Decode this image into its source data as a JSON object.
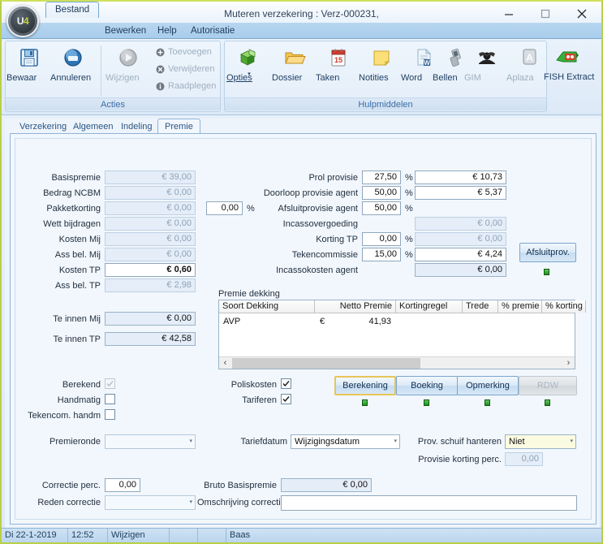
{
  "window": {
    "title": "Muteren verzekering : Verz-000231,",
    "minimize": "minimize-icon",
    "maximize": "maximize-icon",
    "close": "close-icon",
    "orb_u": "U",
    "orb_4": "4"
  },
  "menu": {
    "tabs": [
      {
        "label": "Bestand",
        "active": true
      },
      {
        "label": "Bewerken",
        "active": false
      },
      {
        "label": "Help",
        "active": false
      },
      {
        "label": "Autorisatie",
        "active": false
      }
    ]
  },
  "ribbon": {
    "groups": [
      {
        "name": "Acties"
      },
      {
        "name": "Hulpmiddelen"
      }
    ],
    "acties": {
      "buttons": [
        {
          "label": "Bewaar",
          "icon": "save-icon",
          "disabled": false
        },
        {
          "label": "Annuleren",
          "icon": "cancel-icon",
          "disabled": false
        },
        {
          "label": "Wijzigen",
          "icon": "edit-icon",
          "disabled": true
        }
      ],
      "small_items": [
        {
          "label": "Toevoegen",
          "icon": "add-icon"
        },
        {
          "label": "Verwijderen",
          "icon": "delete-icon"
        },
        {
          "label": "Raadplegen",
          "icon": "info-icon"
        }
      ]
    },
    "hulpmiddelen": {
      "buttons": [
        {
          "label": "Opties",
          "icon": "options-cube-icon",
          "disabled": false,
          "has_dropdown": true
        },
        {
          "label": "Dossier",
          "icon": "folder-icon",
          "disabled": false
        },
        {
          "label": "Taken",
          "icon": "calendar-icon",
          "disabled": false
        },
        {
          "label": "Notities",
          "icon": "note-icon",
          "disabled": false
        },
        {
          "label": "Word",
          "icon": "word-doc-icon",
          "disabled": false
        },
        {
          "label": "Bellen",
          "icon": "phone-icon",
          "disabled": false
        },
        {
          "label": "GIM",
          "icon": "gim-icon",
          "disabled": true
        },
        {
          "label": "Aplaza",
          "icon": "aplaza-icon",
          "disabled": true
        },
        {
          "label": "FISH Extract",
          "icon": "fish-extract-icon",
          "disabled": false
        }
      ]
    }
  },
  "form_tabs": [
    {
      "label": "Verzekering",
      "active": false
    },
    {
      "label": "Algemeen",
      "active": false
    },
    {
      "label": "Indeling",
      "active": false
    },
    {
      "label": "Premie",
      "active": true
    }
  ],
  "left_fields": [
    {
      "label": "Basispremie",
      "value": "€ 39,00",
      "readonly": true
    },
    {
      "label": "Bedrag NCBM",
      "value": "€ 0,00",
      "readonly": true
    },
    {
      "label": "Pakketkorting",
      "value": "€ 0,00",
      "readonly": true
    },
    {
      "label": "Wett bijdragen",
      "value": "€ 0,00",
      "readonly": true
    },
    {
      "label": "Kosten Mij",
      "value": "€ 0,00",
      "readonly": true
    },
    {
      "label": "Ass bel. Mij",
      "value": "€ 0,00",
      "readonly": true
    },
    {
      "label": "Kosten TP",
      "value": "€ 0,60",
      "readonly": false
    },
    {
      "label": "Ass bel. TP",
      "value": "€ 2,98",
      "readonly": true
    }
  ],
  "totals": [
    {
      "label": "Te innen Mij",
      "value": "€ 0,00"
    },
    {
      "label": "Te innen TP",
      "value": "€ 42,58"
    }
  ],
  "provision": {
    "rows": [
      {
        "label": "Prol provisie",
        "pct": "27,50",
        "pct_sign": "%",
        "amount": "€ 10,73",
        "amount_readonly": false,
        "has_pct": true,
        "has_amount": true
      },
      {
        "label": "Doorloop provisie agent",
        "pct": "50,00",
        "pct_sign": "%",
        "amount": "€ 5,37",
        "amount_readonly": false,
        "has_pct": true,
        "has_amount": true
      },
      {
        "label": "Afsluitprovisie agent",
        "pct": "50,00",
        "pct_sign": "%",
        "amount": "",
        "amount_readonly": false,
        "has_pct": true,
        "has_amount": false
      },
      {
        "label": "Incassovergoeding",
        "pct": "",
        "pct_sign": "",
        "amount": "€ 0,00",
        "amount_readonly": true,
        "has_pct": false,
        "has_amount": true
      },
      {
        "label": "Korting TP",
        "pct": "0,00",
        "pct_sign": "%",
        "amount": "€ 0,00",
        "amount_readonly": true,
        "has_pct": true,
        "has_amount": true
      },
      {
        "label": "Tekencommissie",
        "pct": "15,00",
        "pct_sign": "%",
        "amount": "€ 4,24",
        "amount_readonly": false,
        "has_pct": true,
        "has_amount": true
      },
      {
        "label": "Incassokosten agent",
        "pct": "",
        "pct_sign": "",
        "amount": "€ 0,00",
        "amount_readonly": true,
        "has_pct": false,
        "has_amount": true
      }
    ],
    "extra_pct_value": "0,00",
    "extra_pct_sign": "%",
    "afsluitprov_button": "Afsluitprov."
  },
  "grid": {
    "caption": "Premie dekking",
    "columns": [
      "Soort Dekking",
      "",
      "Netto Premie",
      "Kortingregel",
      "Trede",
      "% premie",
      "% korting"
    ],
    "rows": [
      {
        "soort_dekking": "AVP",
        "currency": "€",
        "netto_premie": "41,93",
        "kortingregel": "",
        "trede": "",
        "pct_premie": "",
        "pct_korting": ""
      }
    ],
    "scroll_left_arrow": "‹",
    "scroll_right_arrow": "›"
  },
  "checkboxes_left": [
    {
      "label": "Berekend",
      "checked": true,
      "disabled": true
    },
    {
      "label": "Handmatig",
      "checked": false,
      "disabled": false
    },
    {
      "label": "Tekencom. handm",
      "checked": false,
      "disabled": false
    }
  ],
  "checkboxes_mid": [
    {
      "label": "Poliskosten",
      "checked": true,
      "disabled": false
    },
    {
      "label": "Tariferen",
      "checked": true,
      "disabled": false
    }
  ],
  "action_buttons": [
    {
      "label": "Berekening",
      "disabled": false,
      "focused": true
    },
    {
      "label": "Boeking",
      "disabled": false,
      "focused": false
    },
    {
      "label": "Opmerking",
      "disabled": false,
      "focused": false
    },
    {
      "label": "RDW",
      "disabled": true,
      "focused": false
    }
  ],
  "bottom": {
    "premieronde_label": "Premieronde",
    "premieronde_value": "",
    "tariefdatum_label": "Tariefdatum",
    "tariefdatum_value": "Wijzigingsdatum",
    "prov_schuif_label": "Prov. schuif hanteren",
    "prov_schuif_value": "Niet",
    "provisie_korting_label": "Provisie korting perc.",
    "provisie_korting_value": "0,00",
    "correctie_perc_label": "Correctie perc.",
    "correctie_perc_value": "0,00",
    "bruto_basispremie_label": "Bruto Basispremie",
    "bruto_basispremie_value": "€ 0,00",
    "reden_correctie_label": "Reden correctie",
    "reden_correctie_value": "",
    "omschrijving_correctie_label": "Omschrijving correctie",
    "omschrijving_correctie_value": ""
  },
  "statusbar": {
    "date": "Di 22-1-2019",
    "time": "12:52",
    "mode": "Wijzigen",
    "cell4": "",
    "cell5": "",
    "user": "Baas"
  },
  "colors": {
    "accent": "#b9cf4a",
    "chrome": "#a8cdeb",
    "panel": "#f2f7fd",
    "readonly_field": "#e4edf8",
    "status_green": "#1e8c1e"
  }
}
